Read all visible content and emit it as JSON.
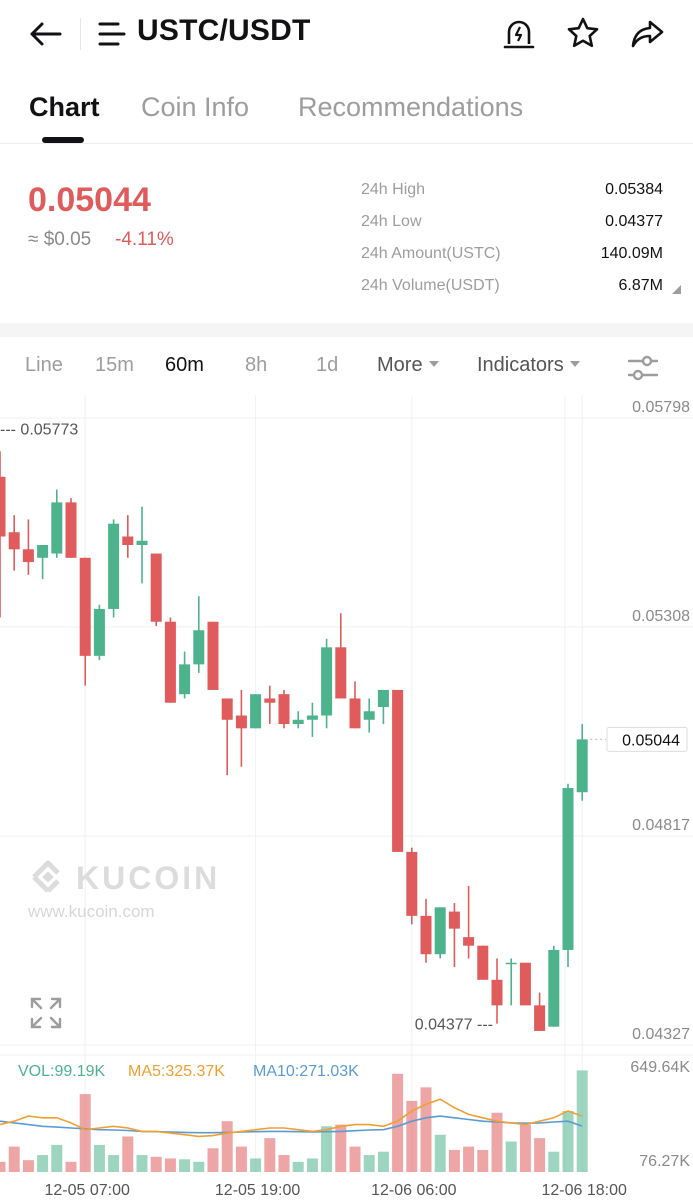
{
  "header": {
    "pair": "USTC/USDT",
    "icons": [
      "back-arrow-icon",
      "menu-icon",
      "price-alert-bell-icon",
      "star-icon",
      "share-icon"
    ]
  },
  "tabs": [
    {
      "label": "Chart",
      "active": true
    },
    {
      "label": "Coin Info",
      "active": false
    },
    {
      "label": "Recommendations",
      "active": false
    }
  ],
  "ticker": {
    "last_price": "0.05044",
    "fiat": "≈ $0.05",
    "change": "-4.11%",
    "stats": [
      {
        "label": "24h High",
        "value": "0.05384"
      },
      {
        "label": "24h Low",
        "value": "0.04377"
      },
      {
        "label": "24h Amount(USTC)",
        "value": "140.09M"
      },
      {
        "label": "24h Volume(USDT)",
        "value": "6.87M"
      }
    ]
  },
  "timeframes": {
    "items": [
      "Line",
      "15m",
      "60m",
      "8h",
      "1d"
    ],
    "active": "60m",
    "more": "More",
    "indicators": "Indicators"
  },
  "colors": {
    "up": "#4db38d",
    "down": "#e05b5b",
    "ma5": "#f0a030",
    "ma10": "#5b9bd5",
    "text": "#121214",
    "muted": "#9d9d9d"
  },
  "watermark": {
    "brand": "KUCOIN",
    "url": "www.kucoin.com"
  },
  "volume_legend": {
    "vol": "VOL:99.19K",
    "ma5": "MA5:325.37K",
    "ma10": "MA10:271.03K"
  },
  "chart_data": {
    "type": "candlestick",
    "price_axis": {
      "ticks": [
        "0.05798",
        "0.05308",
        "0.04817",
        "0.04327"
      ],
      "range": [
        0.04327,
        0.05798
      ]
    },
    "volume_axis": {
      "ticks": [
        "649.64K",
        "76.27K"
      ],
      "range": [
        0,
        649.64
      ]
    },
    "time_labels": [
      {
        "label": "12-05 07:00",
        "index": 6
      },
      {
        "label": "12-05 19:00",
        "index": 18
      },
      {
        "label": "12-06 06:00",
        "index": 29
      },
      {
        "label": "12-06 18:00",
        "index": 41
      }
    ],
    "max_label": "0.05773",
    "min_label": "0.04377",
    "last_price_label": "0.05044",
    "candles": [
      [
        0.0566,
        0.0572,
        0.0533,
        0.0552
      ],
      [
        0.0553,
        0.0557,
        0.0544,
        0.0549
      ],
      [
        0.0549,
        0.0556,
        0.0543,
        0.0546
      ],
      [
        0.0547,
        0.055,
        0.0542,
        0.055
      ],
      [
        0.0548,
        0.0563,
        0.0547,
        0.056
      ],
      [
        0.056,
        0.0561,
        0.0547,
        0.0547
      ],
      [
        0.0547,
        0.0547,
        0.0517,
        0.0524
      ],
      [
        0.0524,
        0.0536,
        0.0523,
        0.0535
      ],
      [
        0.0535,
        0.0556,
        0.0533,
        0.0555
      ],
      [
        0.0552,
        0.0557,
        0.0547,
        0.055
      ],
      [
        0.055,
        0.0559,
        0.0541,
        0.0551
      ],
      [
        0.0548,
        0.0548,
        0.0531,
        0.0532
      ],
      [
        0.0532,
        0.0533,
        0.0513,
        0.0513
      ],
      [
        0.0515,
        0.0525,
        0.0514,
        0.0522
      ],
      [
        0.0522,
        0.0538,
        0.052,
        0.053
      ],
      [
        0.0532,
        0.0532,
        0.0516,
        0.0516
      ],
      [
        0.0514,
        0.0514,
        0.0496,
        0.0509
      ],
      [
        0.051,
        0.0516,
        0.0498,
        0.0507
      ],
      [
        0.0507,
        0.0515,
        0.0507,
        0.0515
      ],
      [
        0.0514,
        0.0517,
        0.0508,
        0.0513
      ],
      [
        0.0515,
        0.0516,
        0.0507,
        0.0508
      ],
      [
        0.0508,
        0.0511,
        0.0507,
        0.0509
      ],
      [
        0.0509,
        0.0513,
        0.0505,
        0.051
      ],
      [
        0.051,
        0.0528,
        0.0507,
        0.0526
      ],
      [
        0.0526,
        0.0534,
        0.0514,
        0.0514
      ],
      [
        0.0514,
        0.0518,
        0.0507,
        0.0507
      ],
      [
        0.0509,
        0.0514,
        0.0506,
        0.0511
      ],
      [
        0.0512,
        0.0516,
        0.0508,
        0.0516
      ],
      [
        0.0516,
        0.0516,
        0.0478,
        0.0478
      ],
      [
        0.0478,
        0.0479,
        0.0461,
        0.0463
      ],
      [
        0.0463,
        0.0467,
        0.0452,
        0.0454
      ],
      [
        0.0454,
        0.0465,
        0.0453,
        0.0465
      ],
      [
        0.0464,
        0.0466,
        0.0451,
        0.046
      ],
      [
        0.0458,
        0.047,
        0.0453,
        0.0456
      ],
      [
        0.0456,
        0.0456,
        0.0448,
        0.0448
      ],
      [
        0.0448,
        0.0453,
        0.04377,
        0.0442
      ],
      [
        0.0452,
        0.0453,
        0.0442,
        0.0452
      ],
      [
        0.0452,
        0.0452,
        0.0442,
        0.0442
      ],
      [
        0.0442,
        0.0445,
        0.0439,
        0.0436
      ],
      [
        0.0437,
        0.0456,
        0.0437,
        0.0455
      ],
      [
        0.0455,
        0.0494,
        0.0451,
        0.0493
      ],
      [
        0.0492,
        0.0508,
        0.049,
        0.05044
      ]
    ],
    "volumes": [
      60,
      150,
      70,
      100,
      160,
      60,
      460,
      160,
      100,
      210,
      100,
      90,
      80,
      75,
      60,
      140,
      300,
      150,
      80,
      200,
      100,
      60,
      80,
      270,
      280,
      150,
      100,
      120,
      580,
      420,
      500,
      220,
      130,
      150,
      130,
      350,
      180,
      280,
      200,
      120,
      360,
      600
    ],
    "ma5": [
      280,
      300,
      330,
      320,
      320,
      290,
      250,
      260,
      270,
      260,
      240,
      240,
      230,
      220,
      210,
      215,
      230,
      240,
      250,
      260,
      260,
      250,
      240,
      250,
      270,
      280,
      280,
      270,
      300,
      360,
      400,
      430,
      380,
      340,
      320,
      300,
      290,
      280,
      300,
      320,
      360,
      330
    ],
    "ma10": [
      300,
      290,
      280,
      270,
      265,
      260,
      255,
      250,
      248,
      245,
      240,
      238,
      236,
      234,
      232,
      232,
      234,
      236,
      238,
      240,
      240,
      238,
      236,
      238,
      240,
      244,
      248,
      250,
      270,
      300,
      320,
      330,
      320,
      310,
      300,
      295,
      290,
      288,
      290,
      295,
      300,
      271
    ]
  }
}
